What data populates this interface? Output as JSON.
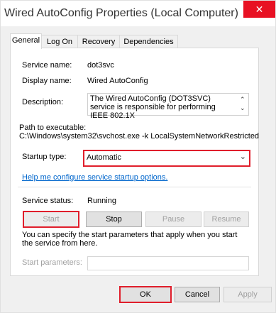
{
  "window": {
    "title": "Wired AutoConfig Properties (Local Computer)",
    "close_symbol": "✕"
  },
  "tabs": [
    {
      "label": "General",
      "active": true
    },
    {
      "label": "Log On",
      "active": false
    },
    {
      "label": "Recovery",
      "active": false
    },
    {
      "label": "Dependencies",
      "active": false
    }
  ],
  "general": {
    "service_name_label": "Service name:",
    "service_name_value": "dot3svc",
    "display_name_label": "Display name:",
    "display_name_value": "Wired AutoConfig",
    "description_label": "Description:",
    "description_value": "The Wired AutoConfig (DOT3SVC) service is responsible for performing IEEE 802.1X",
    "path_label": "Path to executable:",
    "path_value": "C:\\Windows\\system32\\svchost.exe -k LocalSystemNetworkRestricted",
    "startup_type_label": "Startup type:",
    "startup_type_value": "Automatic",
    "help_link": "Help me configure service startup options.",
    "status_label": "Service status:",
    "status_value": "Running",
    "buttons": {
      "start": "Start",
      "stop": "Stop",
      "pause": "Pause",
      "resume": "Resume"
    },
    "start_params_note": "You can specify the start parameters that apply when you start the service from here.",
    "start_params_label": "Start parameters:",
    "start_params_value": ""
  },
  "footer": {
    "ok": "OK",
    "cancel": "Cancel",
    "apply": "Apply"
  },
  "colors": {
    "highlight": "#e01e2b",
    "close_button": "#e81123",
    "link": "#0066cc"
  }
}
